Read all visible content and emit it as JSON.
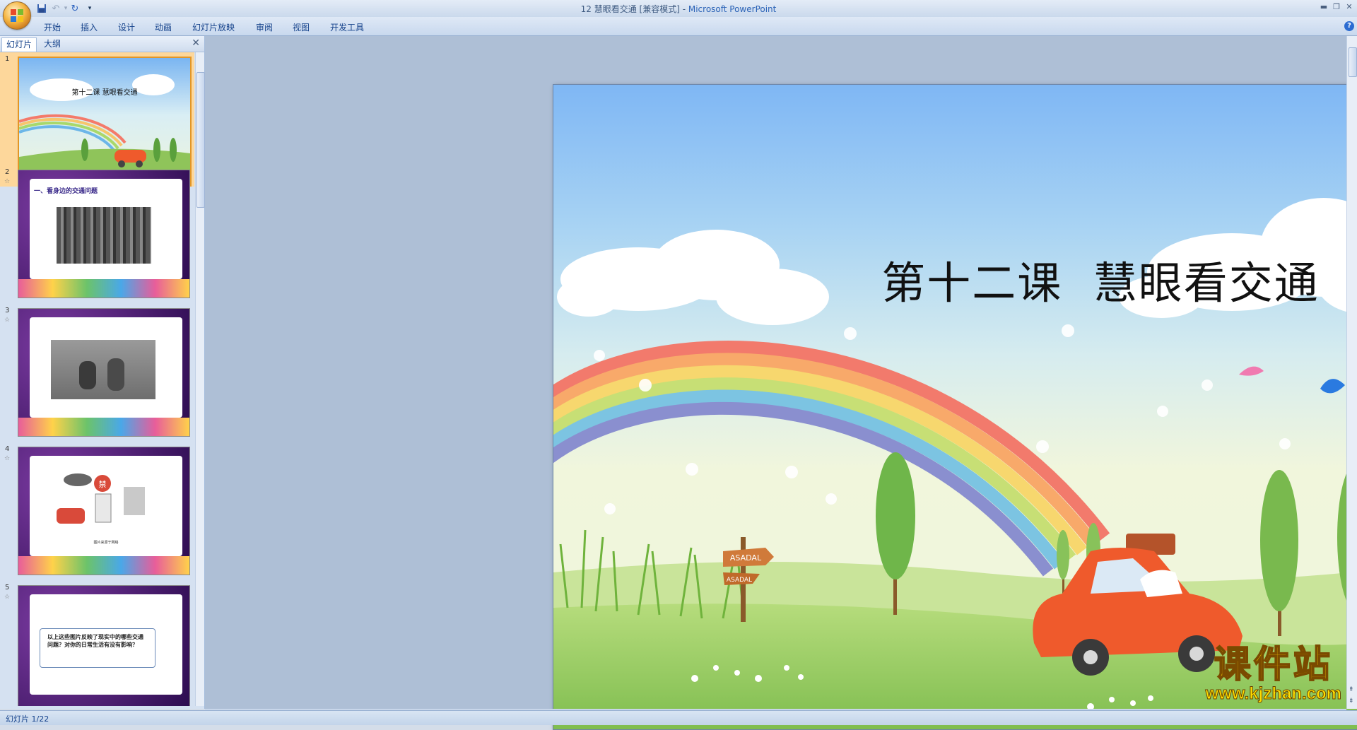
{
  "window": {
    "title_doc": "12 慧眼看交通 [兼容模式] - ",
    "title_app": "Microsoft PowerPoint"
  },
  "ribbon": {
    "tabs": [
      "开始",
      "插入",
      "设计",
      "动画",
      "幻灯片放映",
      "审阅",
      "视图",
      "开发工具"
    ]
  },
  "panel": {
    "tab_slides": "幻灯片",
    "tab_outline": "大纲"
  },
  "thumbnails": [
    {
      "num": "1",
      "title": "第十二课  慧眼看交通"
    },
    {
      "num": "2",
      "heading": "一、看身边的交通问题"
    },
    {
      "num": "3"
    },
    {
      "num": "4",
      "caption": "图片来源于网络",
      "sign": "禁"
    },
    {
      "num": "5",
      "text": "以上这些图片反映了现实中的哪些交通问题？对你的日常生活有没有影响？"
    }
  ],
  "slide": {
    "title": "第十二课  慧眼看交通",
    "sign_top": "ASADAL",
    "sign_bottom": "ASADAL"
  },
  "status": {
    "slide_counter": "幻灯片 1/22"
  },
  "watermark": {
    "cn": "课件站",
    "url": "www.kjzhan.com"
  },
  "colors": {
    "ribbon_text": "#15428b",
    "selection": "#fdd79b",
    "slide_bg": "#aebfd6"
  }
}
